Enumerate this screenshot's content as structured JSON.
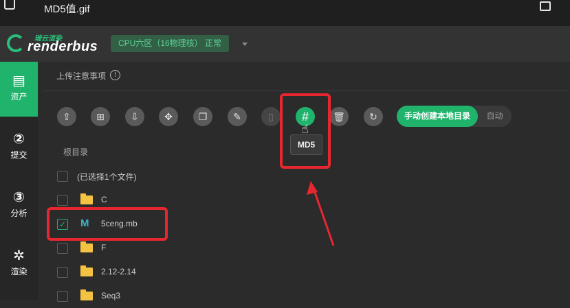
{
  "window": {
    "title": "MD5值.gif"
  },
  "header": {
    "logo_cn": "瑞云渲染",
    "logo_en": "renderbus",
    "cpu_badge": "CPU六区（16物理核）  正常"
  },
  "sidebar": {
    "items": [
      {
        "label": "资产",
        "icon": "asset-icon",
        "glyph": "▤",
        "active": true
      },
      {
        "label": "提交",
        "icon": "submit-icon",
        "glyph": "②",
        "active": false
      },
      {
        "label": "分析",
        "icon": "analyze-icon",
        "glyph": "③",
        "active": false
      },
      {
        "label": "渲染",
        "icon": "render-icon",
        "glyph": "✲",
        "active": false
      }
    ]
  },
  "main": {
    "notice": "上传注意事项",
    "info_glyph": "!",
    "toolbar": [
      {
        "name": "upload-button",
        "glyph": "⇪"
      },
      {
        "name": "new-folder-button",
        "glyph": "⊞"
      },
      {
        "name": "download-button",
        "glyph": "⇩"
      },
      {
        "name": "move-button",
        "glyph": "✥"
      },
      {
        "name": "copy-button",
        "glyph": "❐"
      },
      {
        "name": "rename-button",
        "glyph": "✎"
      },
      {
        "name": "file-button",
        "glyph": "▯"
      },
      {
        "name": "md5-button",
        "glyph": "#"
      },
      {
        "name": "delete-button",
        "glyph": "🗑"
      },
      {
        "name": "refresh-button",
        "glyph": "↻"
      }
    ],
    "tooltip": "MD5",
    "cursor_glyph": "☝",
    "toggle": {
      "on_label": "手动创建本地目录",
      "off_label": "自动"
    },
    "root_label": "根目录",
    "selected_summary": "(已选择1个文件)",
    "files": [
      {
        "name": "C",
        "type": "folder",
        "checked": false
      },
      {
        "name": "5ceng.mb",
        "type": "maya",
        "checked": true
      },
      {
        "name": "F",
        "type": "folder",
        "checked": false
      },
      {
        "name": "2.12-2.14",
        "type": "folder",
        "checked": false
      },
      {
        "name": "Seq3",
        "type": "folder",
        "checked": false
      }
    ],
    "maya_glyph": "M",
    "check_glyph": "✓"
  },
  "colors": {
    "accent": "#1fb36b",
    "highlight": "#e6272f",
    "folder": "#f5c342"
  }
}
